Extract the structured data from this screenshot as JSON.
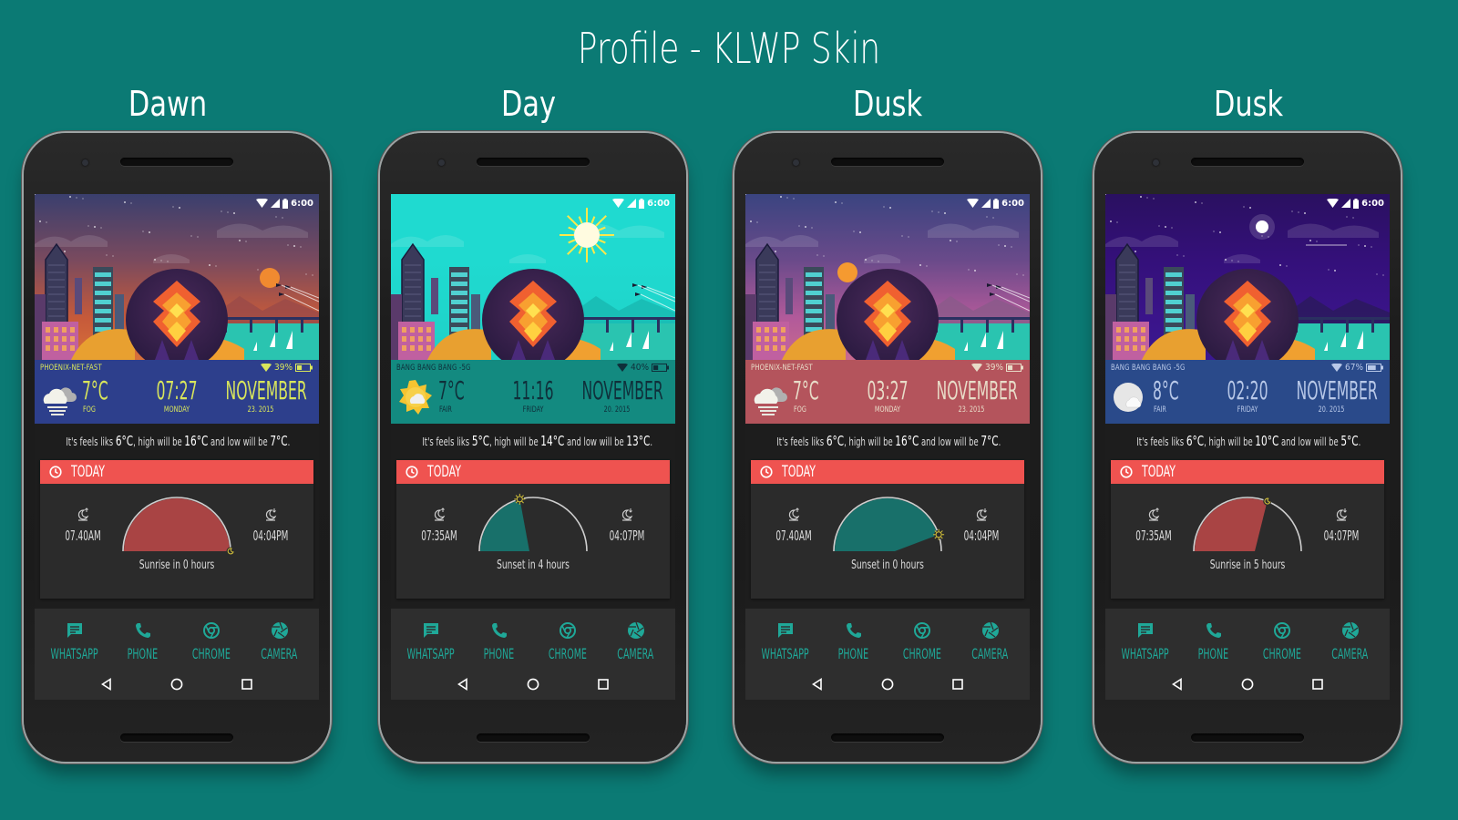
{
  "title": "Profile - KLWP Skin",
  "colors": {
    "background": "#0b7a74",
    "today_bar": "#ef5350",
    "app_accent": "#1fa898",
    "card": "#2b2b2b",
    "sun_icon": "#d4c23a"
  },
  "phones": [
    {
      "label": "Dawn",
      "theme": "dawn",
      "panel_color": "#2d3f8c",
      "text_color": "#d9e65b",
      "status_time": "6:00",
      "network": "PHOENIX-NET-FAST",
      "battery": "39%",
      "weather_icon": "fog-cloud-icon",
      "temperature": "7°C",
      "condition": "FOG",
      "time": "07:27",
      "day": "MONDAY",
      "month": "NOVEMBER",
      "date": "23. 2015",
      "feels": {
        "prefix": "It's feels liks ",
        "feels_like": "6°C",
        "mid": ", high will be ",
        "high": "16°C",
        "mid2": " and low will be ",
        "low": "7°C",
        "suffix": "."
      },
      "today_label": "TODAY",
      "sunrise": "07.40AM",
      "sunset": "04:04PM",
      "arc_fill_color": "#a94444",
      "arc_progress": 1.0,
      "arc_marker": "moon",
      "sun_message": "Sunrise in 0 hours"
    },
    {
      "label": "Day",
      "theme": "day",
      "panel_color": "#138a80",
      "text_color": "#0f2f3a",
      "status_time": "6:00",
      "network": "BANG BANG BANG -5G",
      "battery": "40%",
      "weather_icon": "sun-cloud-icon",
      "temperature": "7°C",
      "condition": "FAIR",
      "time": "11:16",
      "day": "FRIDAY",
      "month": "NOVEMBER",
      "date": "20. 2015",
      "feels": {
        "prefix": "It's feels liks ",
        "feels_like": "5°C",
        "mid": ", high will be ",
        "high": "14°C",
        "mid2": " and low will be ",
        "low": "13°C",
        "suffix": "."
      },
      "today_label": "TODAY",
      "sunrise": "07:35AM",
      "sunset": "04:07PM",
      "arc_fill_color": "#18706a",
      "arc_progress": 0.42,
      "arc_marker": "sun",
      "sun_message": "Sunset in 4 hours"
    },
    {
      "label": "Dusk",
      "theme": "dusk",
      "panel_color": "#b4545c",
      "text_color": "#e8dcc8",
      "status_time": "6:00",
      "network": "PHOENIX-NET-FAST",
      "battery": "39%",
      "weather_icon": "fog-cloud-icon",
      "temperature": "7°C",
      "condition": "FOG",
      "time": "03:27",
      "day": "MONDAY",
      "month": "NOVEMBER",
      "date": "23. 2015",
      "feels": {
        "prefix": "It's feels liks ",
        "feels_like": "6°C",
        "mid": ", high will be ",
        "high": "16°C",
        "mid2": " and low will be ",
        "low": "7°C",
        "suffix": "."
      },
      "today_label": "TODAY",
      "sunrise": "07.40AM",
      "sunset": "04:04PM",
      "arc_fill_color": "#18706a",
      "arc_progress": 0.9,
      "arc_marker": "sun",
      "sun_message": "Sunset in 0 hours"
    },
    {
      "label": "Dusk",
      "theme": "night",
      "panel_color": "#2a4a8a",
      "text_color": "#b8c8e8",
      "status_time": "6:00",
      "network": "BANG BANG BANG -5G",
      "battery": "67%",
      "weather_icon": "moon-cloud-icon",
      "temperature": "8°C",
      "condition": "FAIR",
      "time": "02:20",
      "day": "FRIDAY",
      "month": "NOVEMBER",
      "date": "20. 2015",
      "feels": {
        "prefix": "It's feels liks ",
        "feels_like": "6°C",
        "mid": ", high will be ",
        "high": "10°C",
        "mid2": " and low will be ",
        "low": "5°C",
        "suffix": "."
      },
      "today_label": "TODAY",
      "sunrise": "07:35AM",
      "sunset": "04:07PM",
      "arc_fill_color": "#a94444",
      "arc_progress": 0.62,
      "arc_marker": "moon",
      "sun_message": "Sunrise in 5 hours"
    }
  ],
  "dock_apps": [
    {
      "name": "WHATSAPP",
      "icon": "message-icon"
    },
    {
      "name": "PHONE",
      "icon": "phone-icon"
    },
    {
      "name": "CHROME",
      "icon": "chrome-icon"
    },
    {
      "name": "CAMERA",
      "icon": "camera-aperture-icon"
    }
  ],
  "nav_buttons": [
    "back",
    "home",
    "recents"
  ]
}
